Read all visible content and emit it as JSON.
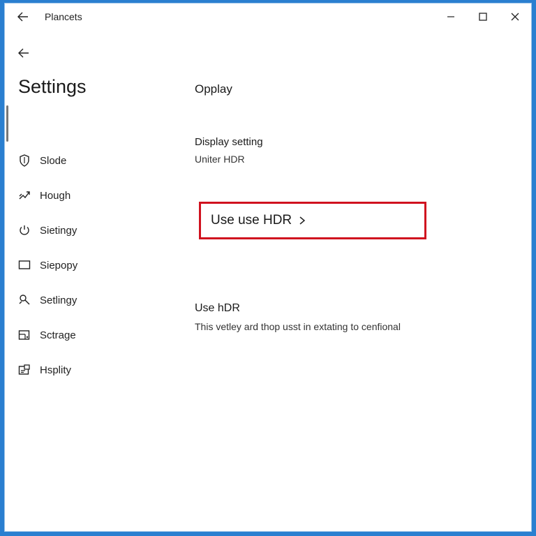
{
  "window": {
    "title": "Plancets"
  },
  "app": {
    "title": "Settings"
  },
  "sidebar": {
    "items": [
      {
        "label": "Slode",
        "icon": "shield-icon"
      },
      {
        "label": "Hough",
        "icon": "network-icon"
      },
      {
        "label": "Sietingy",
        "icon": "power-icon"
      },
      {
        "label": "Siepopy",
        "icon": "display-icon"
      },
      {
        "label": "Setlingy",
        "icon": "search-icon"
      },
      {
        "label": "Sctrage",
        "icon": "storage-icon"
      },
      {
        "label": "Hsplity",
        "icon": "display-settings-icon"
      }
    ]
  },
  "content": {
    "page_title": "Opplay",
    "section_title": "Display setting",
    "section_subtitle": "Uniter HDR",
    "hdr_link_label": "Use use HDR",
    "use_hdr_title": "Use hDR",
    "use_hdr_description": "This vetley ard thop usst in extating to cenfional"
  },
  "colors": {
    "highlight_border": "#d0121f",
    "desktop_background": "#2a7fd0"
  }
}
